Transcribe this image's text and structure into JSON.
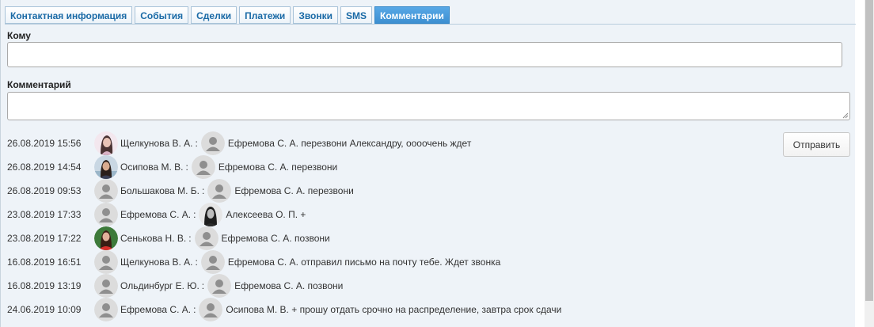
{
  "tabs": [
    {
      "label": "Контактная информация",
      "active": false
    },
    {
      "label": "События",
      "active": false
    },
    {
      "label": "Сделки",
      "active": false
    },
    {
      "label": "Платежи",
      "active": false
    },
    {
      "label": "Звонки",
      "active": false
    },
    {
      "label": "SMS",
      "active": false
    },
    {
      "label": "Комментарии",
      "active": true
    }
  ],
  "form": {
    "to_label": "Кому",
    "to_value": "",
    "comment_label": "Комментарий",
    "comment_value": "",
    "send_label": "Отправить"
  },
  "comments": [
    {
      "date": "26.08.2019 15:56",
      "author": "Щелкунова В. А.",
      "author_avatar": "photo-woman-dark-hair",
      "sep": ":",
      "recipient": "Ефремова С. А.",
      "recipient_avatar": "default-user-icon",
      "text": "перезвони Александру, оооочень ждет"
    },
    {
      "date": "26.08.2019 14:54",
      "author": "Осипова М. В.",
      "author_avatar": "photo-woman-outdoor",
      "sep": ":",
      "recipient": "Ефремова С. А.",
      "recipient_avatar": "default-user-icon",
      "text": "перезвони"
    },
    {
      "date": "26.08.2019 09:53",
      "author": "Большакова М. Б.",
      "author_avatar": "default-user-icon",
      "sep": ":",
      "recipient": "Ефремова С. А.",
      "recipient_avatar": "default-user-icon",
      "text": "перезвони"
    },
    {
      "date": "23.08.2019 17:33",
      "author": "Ефремова С. А.",
      "author_avatar": "default-user-icon",
      "sep": ":",
      "recipient": "Алексеева О. П.",
      "recipient_avatar": "photo-woman-bw",
      "text": "+"
    },
    {
      "date": "23.08.2019 17:22",
      "author": "Сенькова Н. В.",
      "author_avatar": "photo-woman-red",
      "sep": ":",
      "recipient": "Ефремова С. А.",
      "recipient_avatar": "default-user-icon",
      "text": "позвони"
    },
    {
      "date": "16.08.2019 16:51",
      "author": "Щелкунова В. А.",
      "author_avatar": "default-user-icon",
      "sep": ":",
      "recipient": "Ефремова С. А.",
      "recipient_avatar": "default-user-icon",
      "text": "отправил письмо на почту тебе. Ждет звонка"
    },
    {
      "date": "16.08.2019 13:19",
      "author": "Ольдинбург Е. Ю.",
      "author_avatar": "default-user-icon",
      "sep": ":",
      "recipient": "Ефремова С. А.",
      "recipient_avatar": "default-user-icon",
      "text": "позвони"
    },
    {
      "date": "24.06.2019 10:09",
      "author": "Ефремова С. А.",
      "author_avatar": "default-user-icon",
      "sep": ":",
      "recipient": "Осипова М. В.",
      "recipient_avatar": "default-user-icon",
      "text": "+ прошу отдать срочно на распределение, завтра срок сдачи"
    }
  ],
  "colors": {
    "panel_bg": "#eef3f8",
    "tab_text": "#1a6aa6",
    "tab_active_bg": "#4a9bdc",
    "tab_active_text": "#ffffff"
  }
}
